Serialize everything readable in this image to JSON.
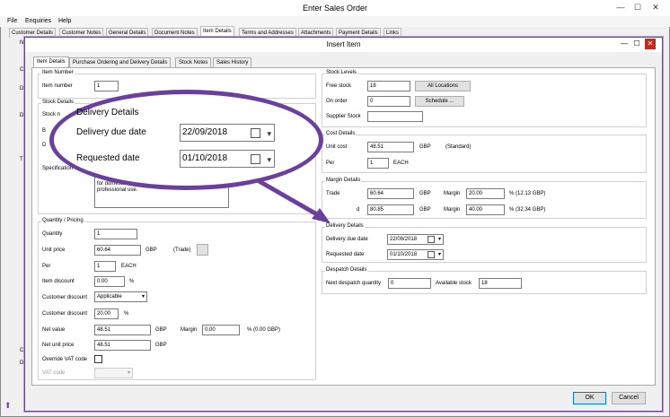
{
  "outer_window": {
    "title": "Enter Sales Order",
    "menu": [
      "File",
      "Enquiries",
      "Help"
    ],
    "tabs": [
      "Customer Details",
      "Customer Notes",
      "General Details",
      "Document Notes",
      "Item Details",
      "Terms and Addresses",
      "Attachments",
      "Payment Details",
      "Links"
    ],
    "active_tab": "Item Details",
    "left_fragments": [
      "N",
      "C",
      "D",
      "D",
      "T",
      "C",
      "D"
    ]
  },
  "dialog": {
    "title": "Insert Item",
    "tabs": [
      "Item Details",
      "Purchase Ordering and Delivery Details",
      "Stock Notes",
      "Sales History"
    ],
    "active_tab": "Item Details",
    "item_number": {
      "group": "Item Number",
      "label": "Item number",
      "value": "1"
    },
    "stock_details": {
      "group": "Stock Details",
      "stock_label": "Stock n",
      "frag_b": "B",
      "frag_d": "D",
      "spec_label": "Specification",
      "spec_text": [
        "for domestic and",
        "professional use."
      ]
    },
    "quantity_pricing": {
      "group": "Quantity / Pricing",
      "quantity_label": "Quantity",
      "quantity": "1",
      "unit_price_label": "Unit price",
      "unit_price": "60.64",
      "unit_price_currency": "GBP",
      "unit_price_note": "(Trade)",
      "per_label": "Per",
      "per": "1",
      "per_unit": "EACH",
      "item_discount_label": "Item discount",
      "item_discount": "0.00",
      "item_discount_unit": "%",
      "customer_discount_label": "Customer discount",
      "customer_discount_option": "Applicable",
      "customer_discount_pct_label": "Customer discount",
      "customer_discount_pct": "20.00",
      "customer_discount_pct_unit": "%",
      "net_value_label": "Net value",
      "net_value": "48.51",
      "net_value_currency": "GBP",
      "margin_label": "Margin",
      "margin": "0.00",
      "margin_note": "% (0.00 GBP)",
      "net_unit_price_label": "Net unit price",
      "net_unit_price": "48.51",
      "net_unit_price_currency": "GBP",
      "override_vat_label": "Override VAT code",
      "vat_code_label": "VAT code"
    },
    "stock_levels": {
      "group": "Stock Levels",
      "free_stock_label": "Free stock",
      "free_stock": "18",
      "all_locations_button": "All Locations",
      "on_order_label": "On order",
      "on_order": "0",
      "schedule_button": "Schedule ...",
      "supplier_stock_label": "Supplier Stock"
    },
    "cost_details": {
      "group": "Cost Details",
      "unit_cost_label": "Unit cost",
      "unit_cost": "48.51",
      "unit_cost_currency": "GBP",
      "unit_cost_note": "(Standard)",
      "per_label": "Per",
      "per": "1",
      "per_unit": "EACH"
    },
    "margin_details": {
      "group": "Margin Details",
      "trade_label": "Trade",
      "trade": "60.64",
      "trade_currency": "GBP",
      "trade_margin_label": "Margin",
      "trade_margin": "20.00",
      "trade_margin_note": "% (12.13 GBP)",
      "second_label": "d",
      "second": "80.85",
      "second_currency": "GBP",
      "second_margin_label": "Margin",
      "second_margin": "40.00",
      "second_margin_note": "% (32.34 GBP)"
    },
    "delivery_details": {
      "group": "Delivery Details",
      "due_label": "Delivery due date",
      "due_date": "22/09/2018",
      "requested_label": "Requested date",
      "requested_date": "01/10/2018"
    },
    "despatch_details": {
      "group": "Despatch Details",
      "next_qty_label": "Next despatch quantity",
      "next_qty": "0",
      "available_label": "Available stock",
      "available": "18"
    },
    "ok_button": "OK",
    "cancel_button": "Cancel"
  },
  "zoom_callout": {
    "group": "Delivery Details",
    "due_label": "Delivery due date",
    "due_date": "22/09/2018",
    "requested_label": "Requested date",
    "requested_date": "01/10/2018",
    "accent": "#6b3fa0"
  }
}
